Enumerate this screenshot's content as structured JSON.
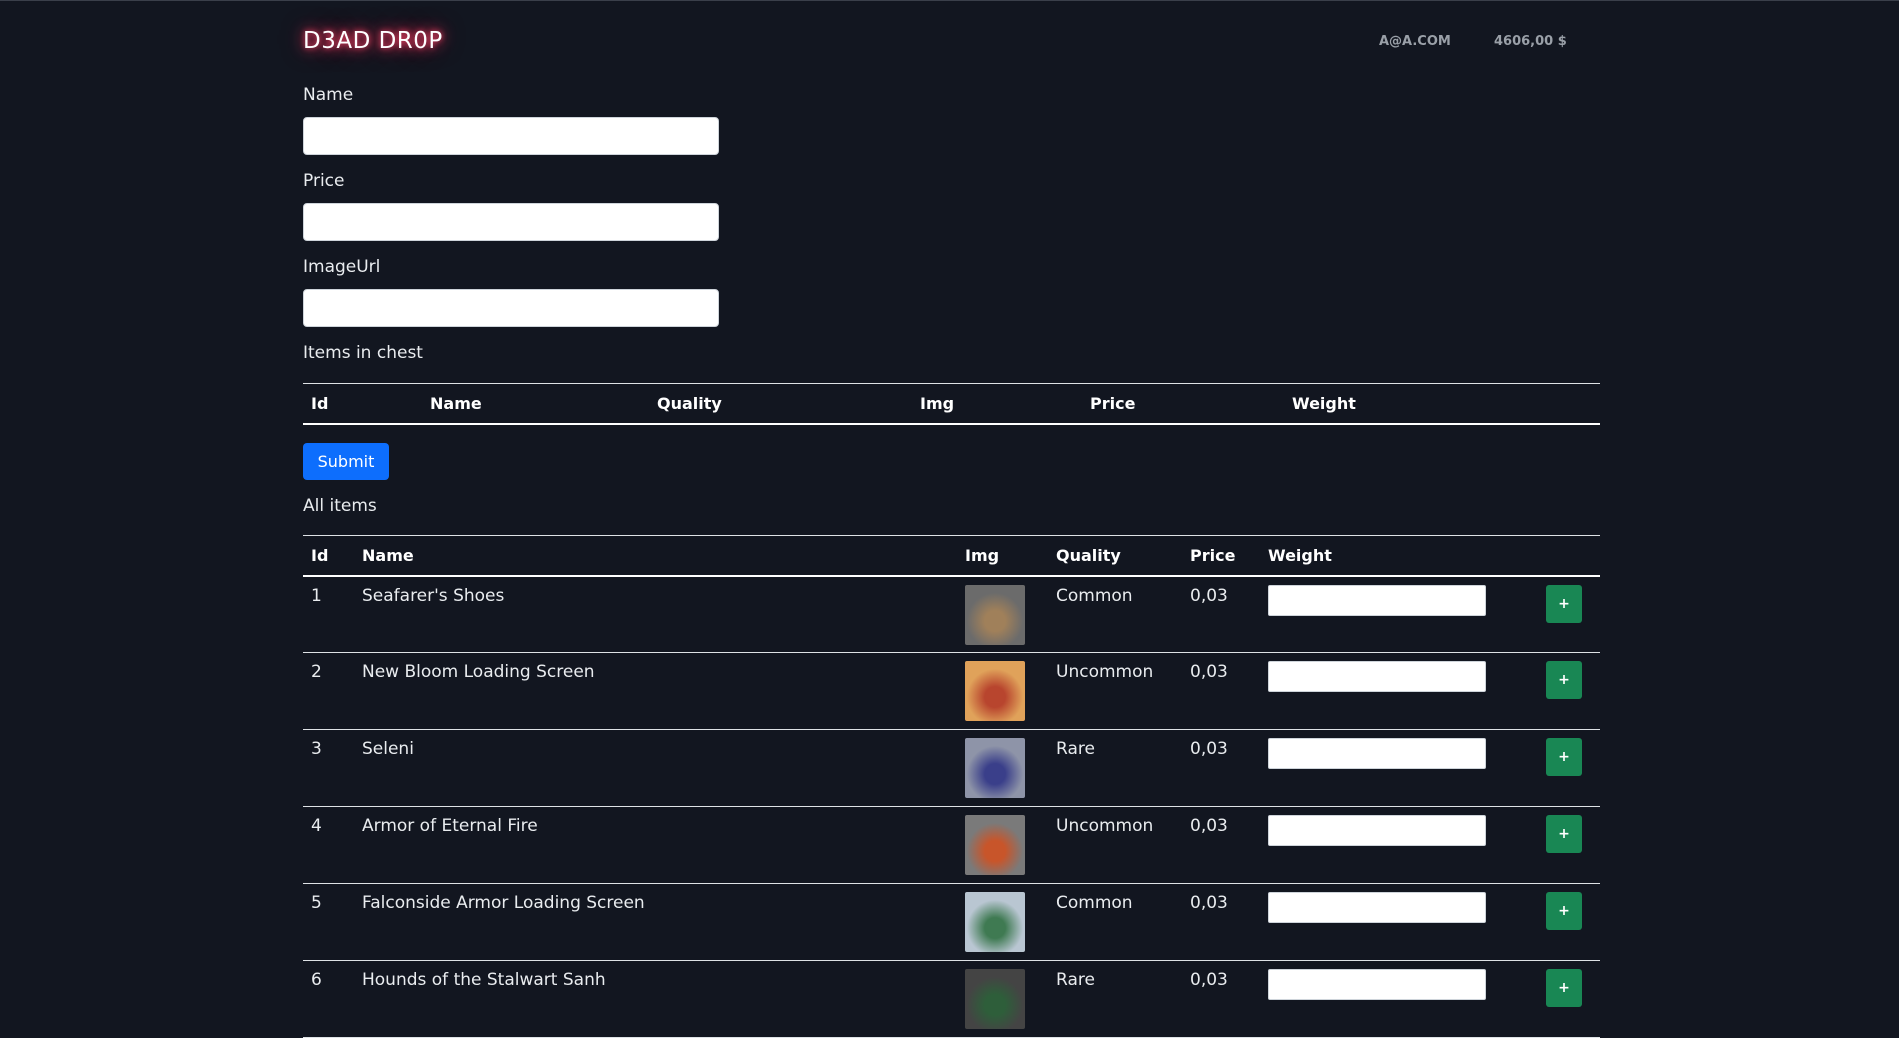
{
  "header": {
    "brand": "D3AD DR0P",
    "email": "A@A.COM",
    "balance": "4606,00 $"
  },
  "form": {
    "name_label": "Name",
    "price_label": "Price",
    "imageurl_label": "ImageUrl",
    "name_value": "",
    "price_value": "",
    "imageurl_value": ""
  },
  "chest": {
    "title": "Items in chest",
    "columns": [
      "Id",
      "Name",
      "Quality",
      "Img",
      "Price",
      "Weight"
    ]
  },
  "submit_label": "Submit",
  "all_items": {
    "title": "All items",
    "columns": [
      "Id",
      "Name",
      "Img",
      "Quality",
      "Price",
      "Weight"
    ],
    "add_label": "+",
    "rows": [
      {
        "id": "1",
        "name": "Seafarer's Shoes",
        "quality": "Common",
        "price": "0,03",
        "img": "boots-image",
        "color1": "#6b6b6b",
        "color2": "#a0805a"
      },
      {
        "id": "2",
        "name": "New Bloom Loading Screen",
        "quality": "Uncommon",
        "price": "0,03",
        "img": "new-bloom-image",
        "color1": "#e0a25a",
        "color2": "#b8452e"
      },
      {
        "id": "3",
        "name": "Seleni",
        "quality": "Rare",
        "price": "0,03",
        "img": "seleni-image",
        "color1": "#8e94a8",
        "color2": "#3a3f8a"
      },
      {
        "id": "4",
        "name": "Armor of Eternal Fire",
        "quality": "Uncommon",
        "price": "0,03",
        "img": "armor-image",
        "color1": "#7a7a7a",
        "color2": "#c8552a"
      },
      {
        "id": "5",
        "name": "Falconside Armor Loading Screen",
        "quality": "Common",
        "price": "0,03",
        "img": "falconside-image",
        "color1": "#b9c6d2",
        "color2": "#3f7a52"
      },
      {
        "id": "6",
        "name": "Hounds of the Stalwart Sanh",
        "quality": "Rare",
        "price": "0,03",
        "img": "hounds-image",
        "color1": "#444444",
        "color2": "#2e5e3a"
      }
    ]
  }
}
